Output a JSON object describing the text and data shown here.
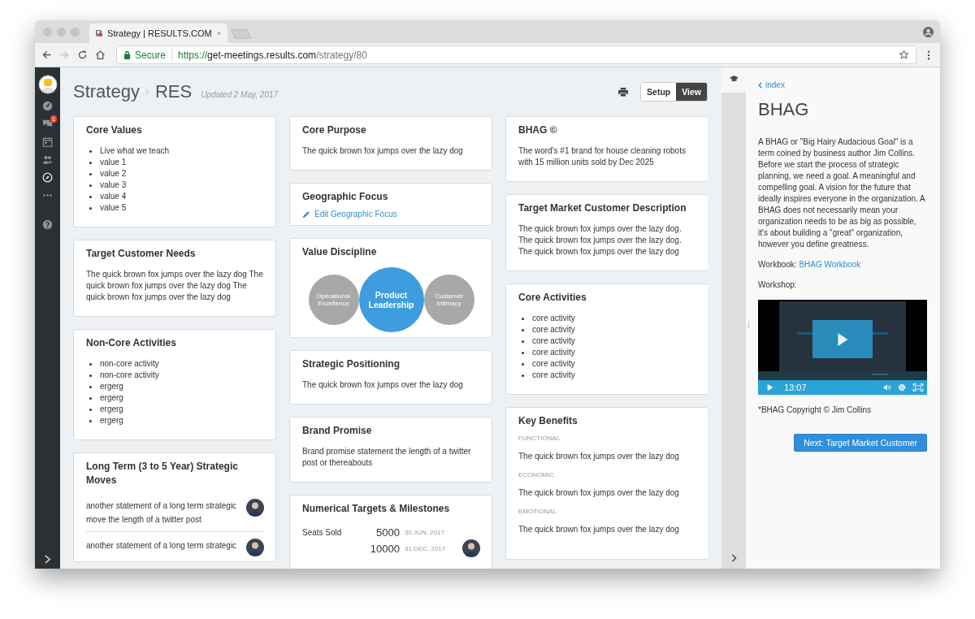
{
  "browser": {
    "tabs": [
      {
        "title": "Strategy | RESULTS.COM",
        "selected": true
      }
    ],
    "nav_buttons": [
      {
        "kind": "back",
        "disabled": false
      },
      {
        "kind": "forward",
        "disabled": true
      },
      {
        "kind": "reload",
        "disabled": false
      },
      {
        "kind": "home",
        "disabled": false
      }
    ],
    "address": {
      "secure_label": "Secure",
      "scheme": "https://",
      "host": "get-meetings.results.com",
      "path": "/strategy/80"
    }
  },
  "sidebar": {
    "items": [
      {
        "kind": "avatar",
        "selected": false
      },
      {
        "kind": "dashboard",
        "selected": false
      },
      {
        "kind": "chat",
        "selected": false,
        "badge": "1"
      },
      {
        "kind": "calendar",
        "selected": false
      },
      {
        "kind": "people",
        "selected": false
      },
      {
        "kind": "compass",
        "selected": true
      },
      {
        "kind": "more",
        "selected": false
      },
      {
        "kind": "help",
        "selected": false
      }
    ]
  },
  "header": {
    "title": "Strategy",
    "subtitle": "RES",
    "updated": "Updated 2 May, 2017",
    "modes": [
      {
        "label": "Setup",
        "selected": false
      },
      {
        "label": "View",
        "selected": true
      }
    ]
  },
  "columns": [
    {
      "cards": [
        {
          "kind": "list",
          "title": "Core Values",
          "items": [
            "Live what we teach",
            "value 1",
            "value 2",
            "value 3",
            "value 4",
            "value 5"
          ]
        },
        {
          "kind": "text",
          "title": "Target Customer Needs",
          "text": "The quick brown fox jumps over the lazy dog The quick brown fox jumps over the lazy dog The quick brown fox jumps over the lazy dog"
        },
        {
          "kind": "list",
          "title": "Non-Core Activities",
          "items": [
            "non-core activity",
            "non-core activity",
            "ergerg",
            "ergerg",
            "ergerg",
            "ergerg"
          ]
        },
        {
          "kind": "moves",
          "title": "Long Term (3 to 5 Year) Strategic Moves",
          "items": [
            {
              "text": "another statement of a long term strategic move the length of a twitter post"
            },
            {
              "text": "another statement of a long term strategic"
            }
          ]
        }
      ]
    },
    {
      "cards": [
        {
          "kind": "text",
          "title": "Core Purpose",
          "text": "The quick brown fox jumps over the lazy dog"
        },
        {
          "kind": "link",
          "title": "Geographic Focus",
          "link": "Edit Geographic Focus"
        },
        {
          "kind": "discipline",
          "title": "Value Discipline",
          "options": [
            {
              "label": "Operational Excellence",
              "selected": false
            },
            {
              "label": "Product Leadership",
              "selected": true
            },
            {
              "label": "Customer Intimacy",
              "selected": false
            }
          ]
        },
        {
          "kind": "text",
          "title": "Strategic Positioning",
          "text": "The quick brown fox jumps over the lazy dog"
        },
        {
          "kind": "text",
          "title": "Brand Promise",
          "text": "Brand promise statement the length of a twitter post or thereabouts"
        },
        {
          "kind": "targets",
          "title": "Numerical Targets & Milestones",
          "rows": [
            {
              "label": "Seats Sold",
              "value": "5000",
              "date": "30 JUN, 2017",
              "assigned": false
            },
            {
              "value": "10000",
              "date": "31 DEC, 2017",
              "assigned": true
            }
          ]
        }
      ]
    },
    {
      "cards": [
        {
          "kind": "text",
          "title": "BHAG ©",
          "text": "The word's #1 brand for house cleaning robots with 15 million units sold by Dec 2025"
        },
        {
          "kind": "text",
          "title": "Target Market Customer Description",
          "text": "The quick brown fox jumps over the lazy dog. The quick brown fox jumps over the lazy dog. The quick brown fox jumps over the lazy dog"
        },
        {
          "kind": "list",
          "title": "Core Activities",
          "items": [
            "core activity",
            "core activity",
            "core activity",
            "core activity",
            "core activity",
            "core activity"
          ]
        },
        {
          "kind": "benefits",
          "title": "Key Benefits",
          "items": [
            {
              "label": "FUNCTIONAL",
              "text": "The quick brown fox jumps over the lazy dog"
            },
            {
              "label": "ECONOMIC",
              "text": "The quick brown fox jumps over the lazy dog"
            },
            {
              "label": "EMOTIONAL",
              "text": "The quick brown fox jumps over the lazy dog"
            }
          ]
        }
      ]
    }
  ],
  "panel": {
    "back_link": "index",
    "title": "BHAG",
    "text": "A BHAG or \"Big Hairy Audacious Goal\" is a term coined by business author Jim Collins. Before we start the process of strategic planning, we need a goal. A meaningful and compelling goal. A vision for the future that ideally inspires everyone in the organization. A BHAG does not necessarily mean your organization needs to be as big as possible, it's about building a \"great\" organization, however you define greatness.",
    "workbook": {
      "label": "Workbook:",
      "link": "BHAG Workbook"
    },
    "workshop_label": "Workshop:",
    "video": {
      "time": "13:07"
    },
    "copyright": "*BHAG Copyright © Jim Collins",
    "next_button": "Next: Target Market Customer"
  }
}
